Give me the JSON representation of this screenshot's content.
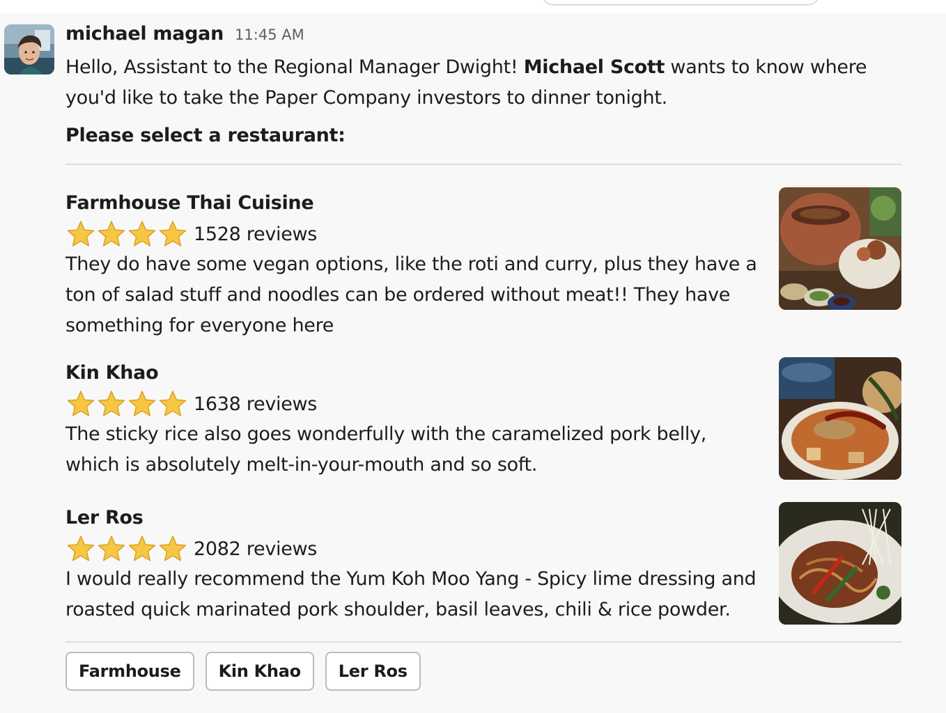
{
  "message": {
    "author": "michael magan",
    "time": "11:45 AM",
    "intro_part1": "Hello, Assistant to the Regional Manager Dwight! ",
    "intro_bold": "Michael Scott",
    "intro_part2": " wants to know where you'd like to take the Paper Company investors to dinner tonight.",
    "prompt": "Please select a restaurant:"
  },
  "restaurants": [
    {
      "name": "Farmhouse Thai Cuisine",
      "stars": 4,
      "reviews": "1528 reviews",
      "review": "They do have some vegan options, like the roti and curry, plus they have a ton of salad stuff and noodles can be ordered without meat!! They have something for everyone here",
      "image_icon": "thai-food-photo"
    },
    {
      "name": "Kin Khao",
      "stars": 4,
      "reviews": "1638 reviews",
      "review": "The sticky rice also goes wonderfully with the caramelized pork belly, which is absolutely melt-in-your-mouth and so soft.",
      "image_icon": "curry-bowl-photo"
    },
    {
      "name": "Ler Ros",
      "stars": 4,
      "reviews": "2082 reviews",
      "review": "I would really recommend the  Yum Koh Moo Yang - Spicy lime dressing and roasted quick marinated pork shoulder, basil leaves, chili & rice powder.",
      "image_icon": "noodle-plate-photo"
    }
  ],
  "buttons": [
    "Farmhouse",
    "Kin Khao",
    "Ler Ros"
  ],
  "colors": {
    "background": "#f8f8f8",
    "text": "#1d1c1d",
    "muted": "#616061",
    "divider": "#dddddd",
    "button_border": "#bbbbbb",
    "star": "#f7c744"
  }
}
